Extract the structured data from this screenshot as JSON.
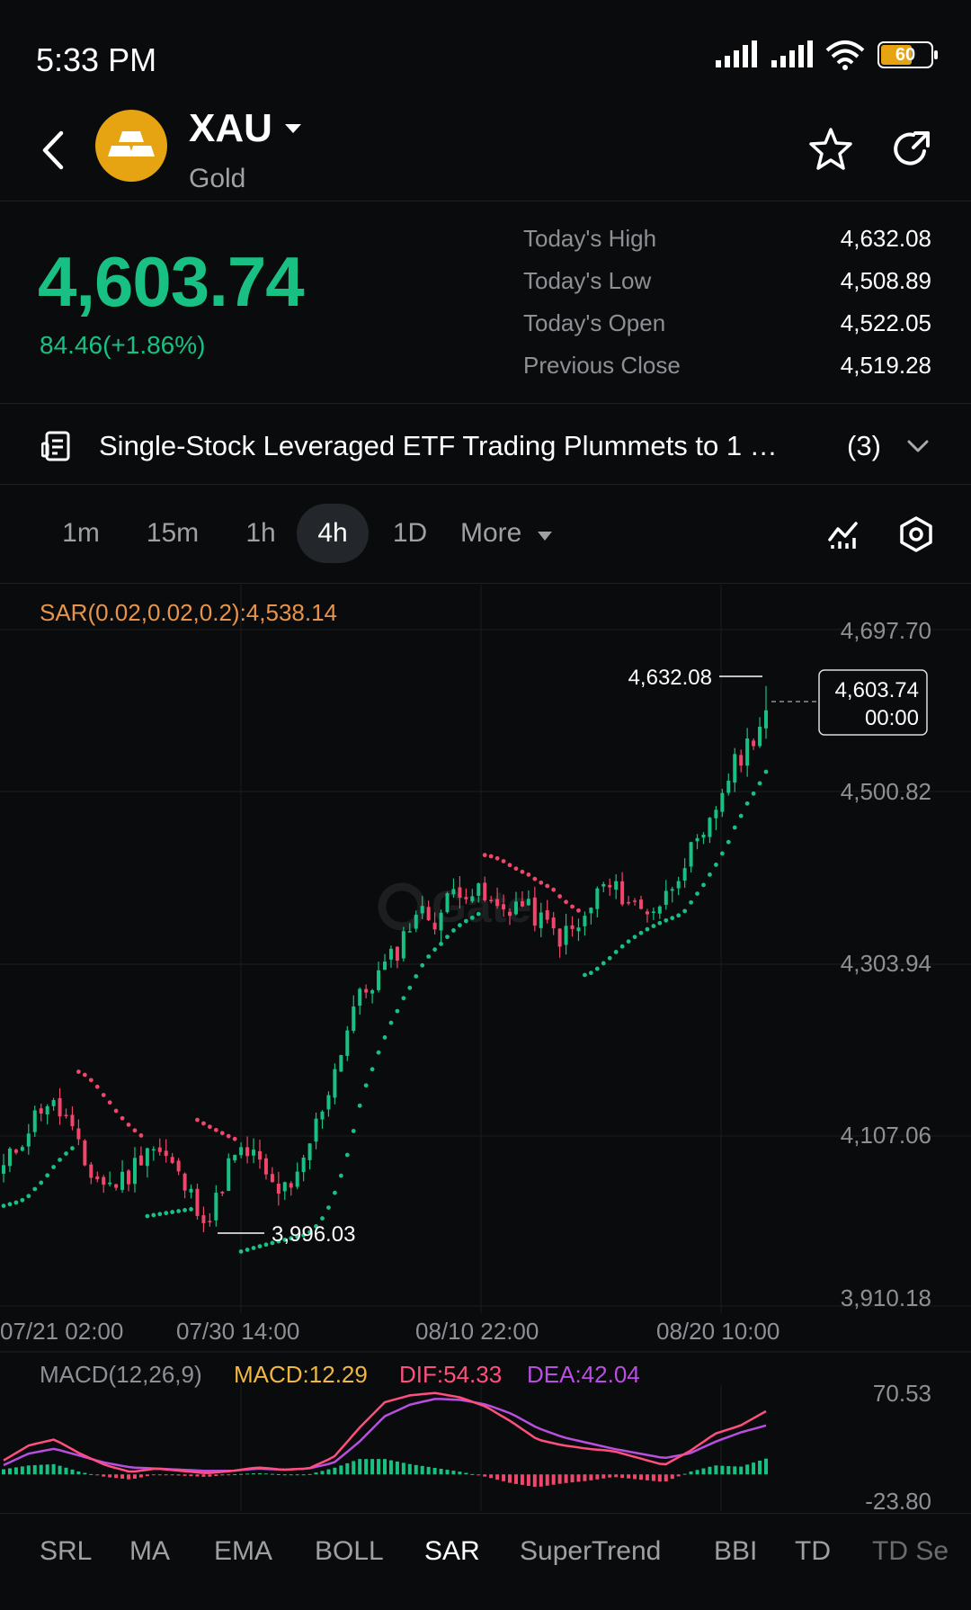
{
  "status_bar": {
    "time": "5:33 PM",
    "battery": "60"
  },
  "header": {
    "ticker": "XAU",
    "name": "Gold"
  },
  "quote": {
    "price": "4,603.74",
    "change": "84.46(+1.86%)",
    "stats": [
      {
        "label": "Today's High",
        "value": "4,632.08"
      },
      {
        "label": "Today's Low",
        "value": "4,508.89"
      },
      {
        "label": "Today's Open",
        "value": "4,522.05"
      },
      {
        "label": "Previous Close",
        "value": "4,519.28"
      }
    ]
  },
  "news": {
    "headline": "Single-Stock Leveraged ETF Trading Plummets to 1 …",
    "count": "(3)"
  },
  "timeframes": [
    {
      "label": "1m"
    },
    {
      "label": "15m"
    },
    {
      "label": "1h"
    },
    {
      "label": "4h"
    },
    {
      "label": "1D"
    },
    {
      "label": "More"
    }
  ],
  "active_timeframe": "4h",
  "chart": {
    "indicator_label": "SAR(0.02,0.02,0.2):4,538.14",
    "price_axis": [
      "4,697.70",
      "4,500.82",
      "4,303.94",
      "4,107.06",
      "3,910.18"
    ],
    "time_axis": [
      "07/21 02:00",
      "07/30 14:00",
      "08/10 22:00",
      "08/20 10:00"
    ],
    "high_marker": "4,632.08",
    "low_marker": "3,996.03",
    "last_price_box": {
      "price": "4,603.74",
      "time": "00:00"
    },
    "watermark": "Gate"
  },
  "macd": {
    "label": "MACD(12,26,9)",
    "macd": "MACD:12.29",
    "dif": "DIF:54.33",
    "dea": "DEA:42.04",
    "axis_top": "70.53",
    "axis_bottom": "-23.80"
  },
  "indicator_tabs": [
    "SRL",
    "MA",
    "EMA",
    "BOLL",
    "SAR",
    "SuperTrend",
    "BBI",
    "TD",
    "TD Se"
  ],
  "active_indicator": "SAR",
  "colors": {
    "up": "#19c084",
    "down": "#f0466b",
    "accent": "#e6a312",
    "sar_label": "#e8944a",
    "macd": "#f0b840",
    "dif": "#ff4f7e",
    "dea": "#b84fe0"
  },
  "chart_data": {
    "type": "candlestick",
    "timeframe": "4h",
    "ylim": [
      3910.18,
      4697.7
    ],
    "high": 4632.08,
    "low": 3996.03,
    "last": 4603.74,
    "close_path": [
      4070,
      4110,
      4150,
      4130,
      4070,
      4050,
      4060,
      4100,
      4080,
      4040,
      4010,
      4080,
      4090,
      4050,
      4040,
      4110,
      4180,
      4260,
      4290,
      4320,
      4370,
      4360,
      4400,
      4390,
      4370,
      4380,
      4360,
      4340,
      4350,
      4400,
      4390,
      4370,
      4380,
      4430,
      4450,
      4520,
      4560,
      4600
    ],
    "macd": {
      "ylim": [
        -23.8,
        70.53
      ],
      "dif": [
        12,
        25,
        30,
        18,
        8,
        2,
        5,
        3,
        1,
        3,
        6,
        4,
        5,
        15,
        40,
        62,
        68,
        70,
        66,
        58,
        45,
        30,
        25,
        22,
        20,
        14,
        8,
        20,
        35,
        42,
        54.33
      ],
      "dea": [
        8,
        18,
        22,
        16,
        10,
        6,
        5,
        4,
        3,
        3,
        5,
        4,
        5,
        10,
        28,
        50,
        60,
        65,
        64,
        60,
        52,
        40,
        32,
        27,
        22,
        18,
        14,
        18,
        28,
        36,
        42.04
      ]
    }
  }
}
